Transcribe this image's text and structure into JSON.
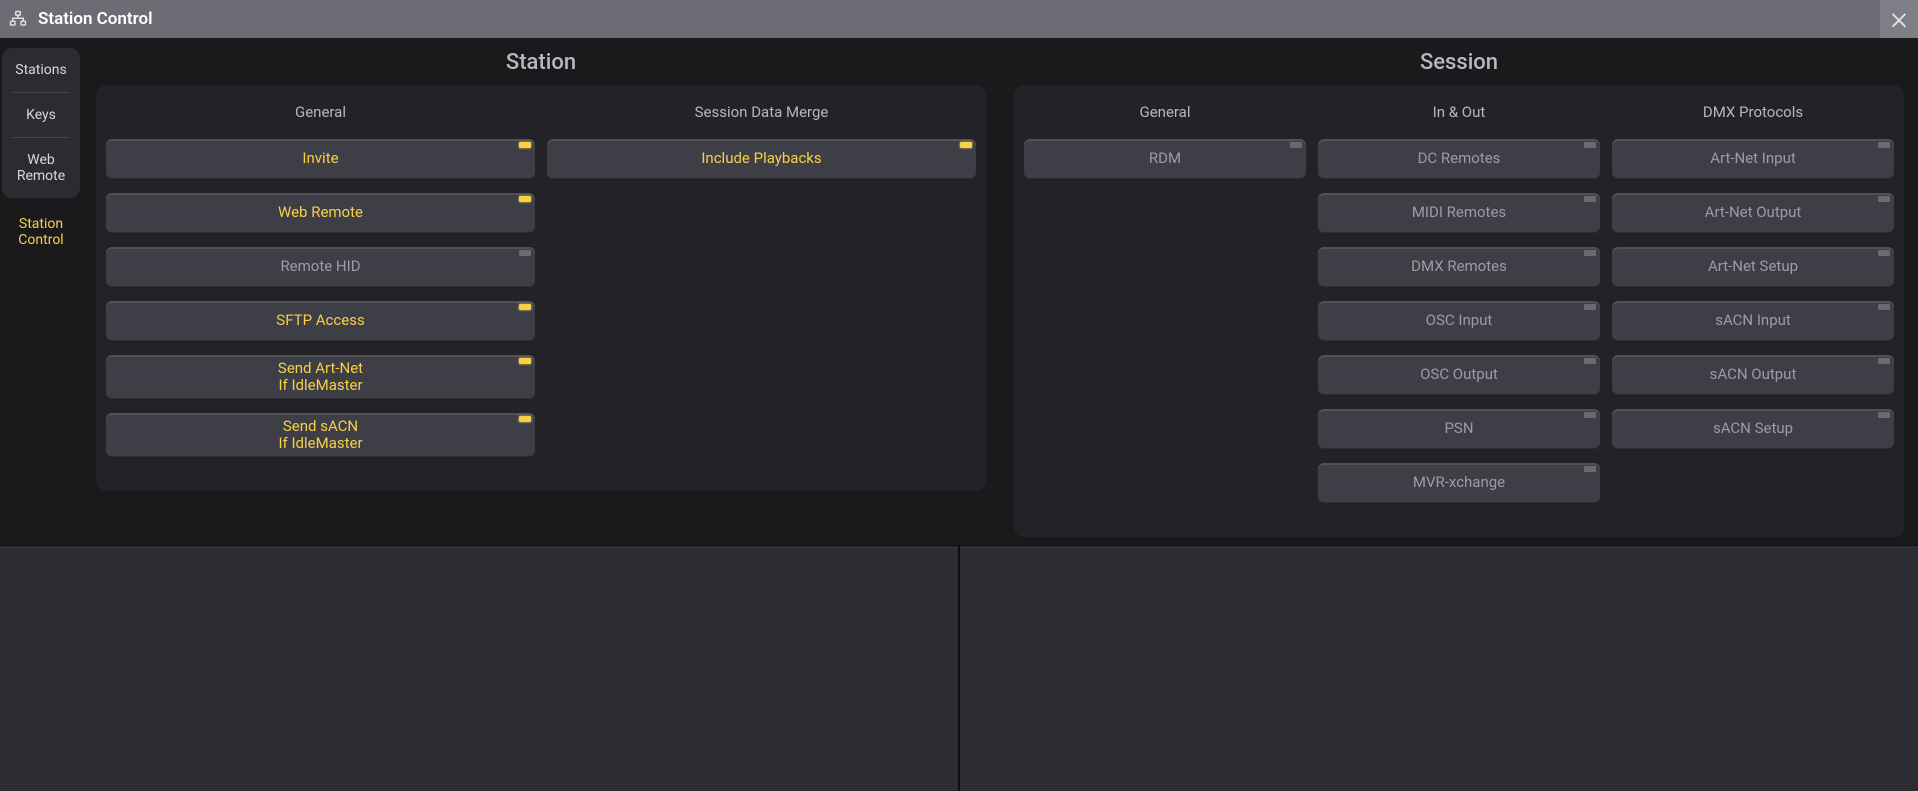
{
  "title": "Station Control",
  "sidebar": {
    "tabs": [
      {
        "label": "Stations"
      },
      {
        "label": "Keys"
      },
      {
        "label": "Web Remote"
      }
    ],
    "active": "Station Control"
  },
  "station": {
    "title": "Station",
    "columns": [
      {
        "header": "General",
        "buttons": [
          {
            "label": "Invite",
            "state": "on"
          },
          {
            "label": "Web Remote",
            "state": "on"
          },
          {
            "label": "Remote HID",
            "state": "off"
          },
          {
            "label": "SFTP Access",
            "state": "on"
          },
          {
            "label": "Send Art-Net If IdleMaster",
            "state": "on",
            "multiline": true
          },
          {
            "label": "Send sACN If IdleMaster",
            "state": "on",
            "multiline": true
          }
        ]
      },
      {
        "header": "Session Data Merge",
        "buttons": [
          {
            "label": "Include Playbacks",
            "state": "on"
          }
        ]
      }
    ]
  },
  "session": {
    "title": "Session",
    "columns": [
      {
        "header": "General",
        "buttons": [
          {
            "label": "RDM",
            "state": "off"
          }
        ]
      },
      {
        "header": "In & Out",
        "buttons": [
          {
            "label": "DC Remotes",
            "state": "off"
          },
          {
            "label": "MIDI Remotes",
            "state": "off"
          },
          {
            "label": "DMX Remotes",
            "state": "off"
          },
          {
            "label": "OSC Input",
            "state": "off"
          },
          {
            "label": "OSC Output",
            "state": "off"
          },
          {
            "label": "PSN",
            "state": "off"
          },
          {
            "label": "MVR-xchange",
            "state": "off"
          }
        ]
      },
      {
        "header": "DMX Protocols",
        "buttons": [
          {
            "label": "Art-Net Input",
            "state": "off"
          },
          {
            "label": "Art-Net Output",
            "state": "off"
          },
          {
            "label": "Art-Net Setup",
            "state": "off"
          },
          {
            "label": "sACN Input",
            "state": "off"
          },
          {
            "label": "sACN Output",
            "state": "off"
          },
          {
            "label": "sACN Setup",
            "state": "off"
          }
        ]
      }
    ]
  }
}
